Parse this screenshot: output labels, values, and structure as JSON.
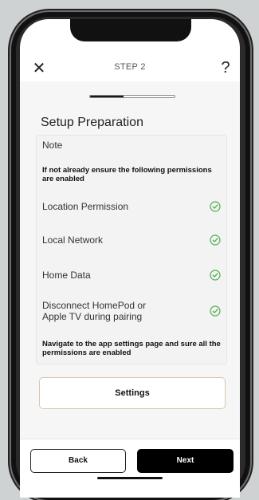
{
  "header": {
    "step_title": "STEP 2",
    "close_label": "✕",
    "help_label": "?"
  },
  "progress": {
    "fraction": 0.4
  },
  "section": {
    "title": "Setup Preparation"
  },
  "note": {
    "label": "Note",
    "intro": "If not already ensure the following permissions are enabled",
    "permissions": [
      {
        "label": "Location Permission",
        "enabled": true
      },
      {
        "label": "Local Network",
        "enabled": true
      },
      {
        "label": "Home Data",
        "enabled": true
      },
      {
        "label": "Disconnect HomePod or Apple TV during pairing",
        "enabled": true
      }
    ],
    "footer": "Navigate to the app settings page and sure all the permissions are enabled"
  },
  "settings_button": {
    "label": "Settings"
  },
  "footer_buttons": {
    "back_label": "Back",
    "next_label": "Next"
  },
  "colors": {
    "check": "#4caf50",
    "primary_button": "#000000",
    "settings_border": "#d8c6a8"
  },
  "icons": {
    "close": "close-icon",
    "help": "help-icon",
    "check": "check-circle-icon"
  }
}
